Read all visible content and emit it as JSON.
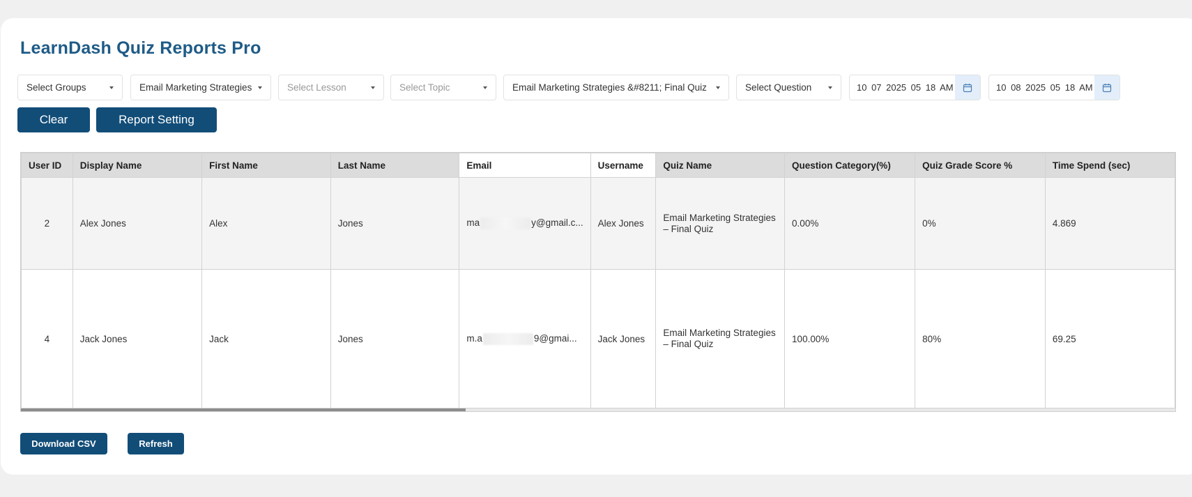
{
  "app": {
    "title": "LearnDash Quiz Reports Pro"
  },
  "filters": {
    "groups": "Select Groups",
    "course": "Email Marketing Strategies",
    "lesson": "Select Lesson",
    "topic": "Select Topic",
    "quiz": "Email Marketing Strategies &#8211; Final Quiz",
    "question": "Select Question",
    "date_from": "10 07 2025 05 18 AM",
    "date_to": "10 08 2025 05 18 AM"
  },
  "icons": {
    "calendar": "calendar-icon",
    "caret": "caret-down-icon"
  },
  "buttons": {
    "clear": "Clear",
    "report_setting": "Report Setting",
    "download_csv": "Download CSV",
    "refresh": "Refresh"
  },
  "table": {
    "headers": [
      "User ID",
      "Display Name",
      "First Name",
      "Last Name",
      "Email",
      "Username",
      "Quiz Name",
      "Question Category(%)",
      "Quiz Grade Score %",
      "Time Spend (sec)"
    ],
    "rows": [
      {
        "user_id": "2",
        "display_name": "Alex Jones",
        "first_name": "Alex",
        "last_name": "Jones",
        "email_start": "ma",
        "email_end": "y@gmail.c...",
        "username": "Alex Jones",
        "quiz_name": "Email Marketing Strategies – Final Quiz",
        "question_category": "0.00%",
        "grade_score": "0%",
        "time_spend": "4.869"
      },
      {
        "user_id": "4",
        "display_name": "Jack Jones",
        "first_name": "Jack",
        "last_name": "Jones",
        "email_start": "m.a",
        "email_end": "9@gmai...",
        "username": "Jack Jones",
        "quiz_name": "Email Marketing Strategies – Final Quiz",
        "question_category": "100.00%",
        "grade_score": "80%",
        "time_spend": "69.25"
      }
    ]
  },
  "colors": {
    "primary": "#124d78",
    "title": "#1e5b87",
    "header_bg": "#dcdcdc",
    "page_bg": "#f0f0f0"
  }
}
